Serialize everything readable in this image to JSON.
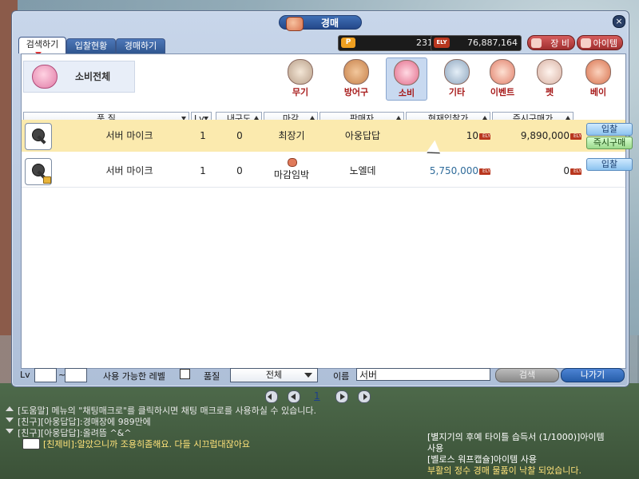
{
  "window": {
    "title": "경매",
    "close": "×"
  },
  "tabs": [
    {
      "label": "검색하기"
    },
    {
      "label": "입찰현황"
    },
    {
      "label": "경매하기"
    }
  ],
  "currency": {
    "points_icon": "P",
    "points": "231",
    "ely_icon": "ELY",
    "ely": "76,887,164"
  },
  "header_buttons": {
    "equip": "장 비",
    "item": "아이템"
  },
  "summary": {
    "label": "소비전체"
  },
  "categories": [
    {
      "label": "무기",
      "icon": "sword-icon"
    },
    {
      "label": "방어구",
      "icon": "armor-icon"
    },
    {
      "label": "소비",
      "icon": "potion-icon"
    },
    {
      "label": "기타",
      "icon": "etc-icon"
    },
    {
      "label": "이벤트",
      "icon": "event-icon"
    },
    {
      "label": "펫",
      "icon": "pet-icon"
    },
    {
      "label": "베이",
      "icon": "bei-icon"
    }
  ],
  "filters": {
    "quality": "품 질",
    "lv": "Lv",
    "durability": "내구도",
    "deadline": "마감",
    "seller": "판매자",
    "current_bid": "현재입찰가",
    "buyout": "즉시구매가"
  },
  "rows": [
    {
      "name": "서버 마이크",
      "lv": "1",
      "durability": "0",
      "deadline": "최장기",
      "seller": "아웅답답",
      "bid": "10",
      "buyout": "9,890,000",
      "bid_btn": "입찰",
      "buy_btn": "즉시구매"
    },
    {
      "name": "서버 마이크",
      "lv": "1",
      "durability": "0",
      "deadline": "마감임박",
      "seller": "노엘데",
      "bid": "5,750,000",
      "buyout": "0",
      "bid_btn": "입찰"
    }
  ],
  "currency_tag": "ELY",
  "pager": {
    "page": "1"
  },
  "bottom": {
    "lv_label": "Lv",
    "tilde": "~",
    "usable_level": "사용 가능한 레벨",
    "quality_label": "품질",
    "quality_value": "전체",
    "name_label": "이름",
    "name_value": "서버",
    "search": "검색",
    "exit": "나가기"
  },
  "chat": [
    {
      "text": "[도움말] 메뉴의 \"채팅매크로\"를 클릭하시면 채팅 매크로를 사용하실 수 있습니다.",
      "color": "#e9e9e9"
    },
    {
      "text": "[친구][아웅답답]:경매장에 989만에",
      "color": "#e9e9e9"
    },
    {
      "text": "[친구][아웅답답]:올려뜸 ^&^",
      "color": "#e9e9e9"
    },
    {
      "text": "[친제비]:알았으니까 조용히좀해요. 다들 시끄럽대잖아요",
      "color": "#ffe37a"
    }
  ],
  "system_messages": [
    {
      "text": "[별지기의 후예 타이틀 습득서 (1/1000)]아이템",
      "color": "#ffffff"
    },
    {
      "text": "사용",
      "color": "#ffffff"
    },
    {
      "text": "[벨로스 워프캡슐]아이템 사용",
      "color": "#ffffff"
    },
    {
      "text": "부활의 정수 경매 물품이 낙찰 되었습니다.",
      "color": "#ffe37a"
    }
  ]
}
